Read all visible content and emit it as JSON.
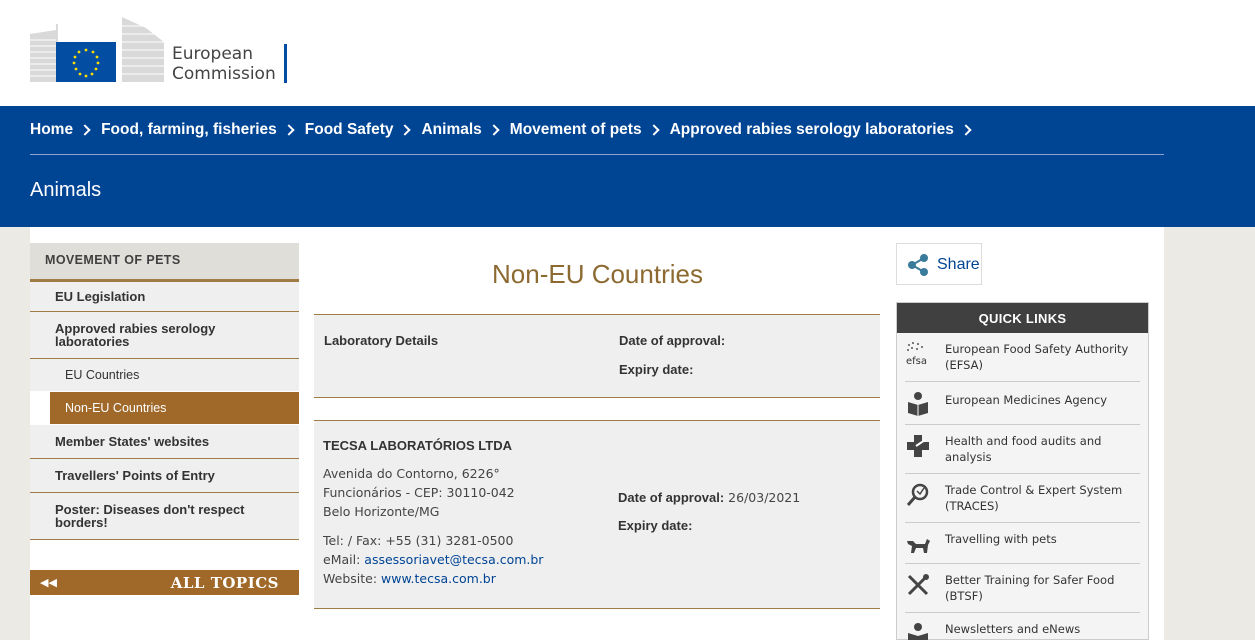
{
  "header": {
    "logo_line1": "European",
    "logo_line2": "Commission"
  },
  "breadcrumb": [
    "Home",
    "Food, farming, fisheries",
    "Food Safety",
    "Animals",
    "Movement of pets",
    "Approved rabies serology laboratories"
  ],
  "site_title": "Animals",
  "left_menu": {
    "heading": "MOVEMENT OF PETS",
    "items": [
      "EU Legislation",
      "Approved rabies serology laboratories",
      "EU Countries",
      "Non-EU Countries",
      "Member States' websites",
      "Travellers' Points of Entry",
      "Poster: Diseases don't respect borders!"
    ],
    "all_topics": "ALL TOPICS"
  },
  "main": {
    "title": "Non-EU Countries",
    "table_header": {
      "col1": "Laboratory Details",
      "approval_label": "Date of approval:",
      "expiry_label": "Expiry date:"
    },
    "lab": {
      "name": "TECSA LABORATÓRIOS LTDA",
      "address1": "Avenida do Contorno, 6226°",
      "address2": "Funcionários - CEP: 30110-042",
      "address3": "Belo Horizonte/MG",
      "tel": "Tel: / Fax: +55 (31) 3281-0500",
      "email_label": "eMail: ",
      "email": "assessoriavet@tecsa.com.br",
      "website_label": "Website: ",
      "website": "www.tecsa.com.br",
      "approval_label": "Date of approval:",
      "approval_date": "26/03/2021",
      "expiry_label": "Expiry date:"
    }
  },
  "share_label": "Share",
  "quick_links": {
    "heading": "QUICK LINKS",
    "items": [
      {
        "label": "European Food Safety Authority (EFSA)",
        "icon": "efsa-icon"
      },
      {
        "label": "European Medicines Agency",
        "icon": "medicines-icon"
      },
      {
        "label": "Health and food audits and analysis",
        "icon": "health-cross-icon"
      },
      {
        "label": "Trade Control & Expert System (TRACES)",
        "icon": "magnifier-icon"
      },
      {
        "label": "Travelling with pets",
        "icon": "dog-icon"
      },
      {
        "label": "Better Training for Safer Food (BTSF)",
        "icon": "cutlery-icon"
      },
      {
        "label": "Newsletters and eNews",
        "icon": "newsletter-icon"
      }
    ]
  },
  "colors": {
    "nav_blue": "#004494",
    "accent_brown": "#a0692a",
    "title_brown": "#8c6a31"
  }
}
